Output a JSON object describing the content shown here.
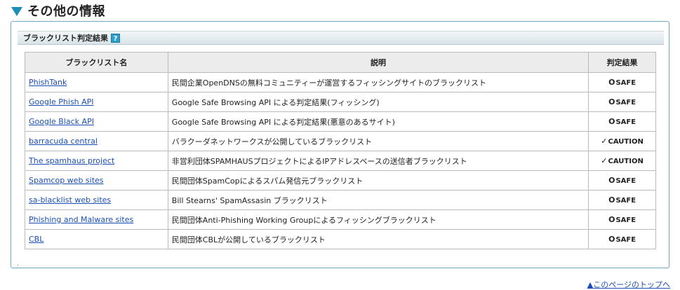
{
  "section": {
    "title": "その他の情報",
    "icon": "triangle-down-icon"
  },
  "panel": {
    "title": "ブラックリスト判定結果",
    "help_label": "?"
  },
  "table": {
    "headers": [
      "ブラックリスト名",
      "説明",
      "判定結果"
    ],
    "rows": [
      {
        "name": "PhishTank",
        "desc": "民間企業OpenDNSの無料コミュニティーが運営するフィッシングサイトのブラックリスト",
        "mark": "O",
        "result": "SAFE",
        "status": "safe"
      },
      {
        "name": "Google Phish API",
        "desc": "Google Safe Browsing API による判定結果(フィッシング)",
        "mark": "O",
        "result": "SAFE",
        "status": "safe"
      },
      {
        "name": "Google Black API",
        "desc": "Google Safe Browsing API による判定結果(悪意のあるサイト)",
        "mark": "O",
        "result": "SAFE",
        "status": "safe"
      },
      {
        "name": "barracuda central",
        "desc": "バラクーダネットワークスが公開しているブラックリスト",
        "mark": "✓",
        "result": "CAUTION",
        "status": "caution"
      },
      {
        "name": "The spamhaus project",
        "desc": "非営利団体SPAMHAUSプロジェクトによるIPアドレスベースの送信者ブラックリスト",
        "mark": "✓",
        "result": "CAUTION",
        "status": "caution"
      },
      {
        "name": "Spamcop web sites",
        "desc": "民間団体SpamCopによるスパム発信元ブラックリスト",
        "mark": "O",
        "result": "SAFE",
        "status": "safe"
      },
      {
        "name": "sa-blacklist web sites",
        "desc": "Bill Stearns' SpamAssasin ブラックリスト",
        "mark": "O",
        "result": "SAFE",
        "status": "safe"
      },
      {
        "name": "Phishing and Malware sites",
        "desc": "民間団体Anti-Phishing Working Groupによるフィッシングブラックリスト",
        "mark": "O",
        "result": "SAFE",
        "status": "safe"
      },
      {
        "name": "CBL",
        "desc": "民間団体CBLが公開しているブラックリスト",
        "mark": "O",
        "result": "SAFE",
        "status": "safe"
      }
    ]
  },
  "footer": {
    "dot": ".",
    "to_top_label": "▲このページのトップへ"
  },
  "colors": {
    "accent": "#1b8fb5",
    "safe": "#3fb3d4",
    "caution": "#cc1111",
    "link": "#1a4fb3"
  }
}
